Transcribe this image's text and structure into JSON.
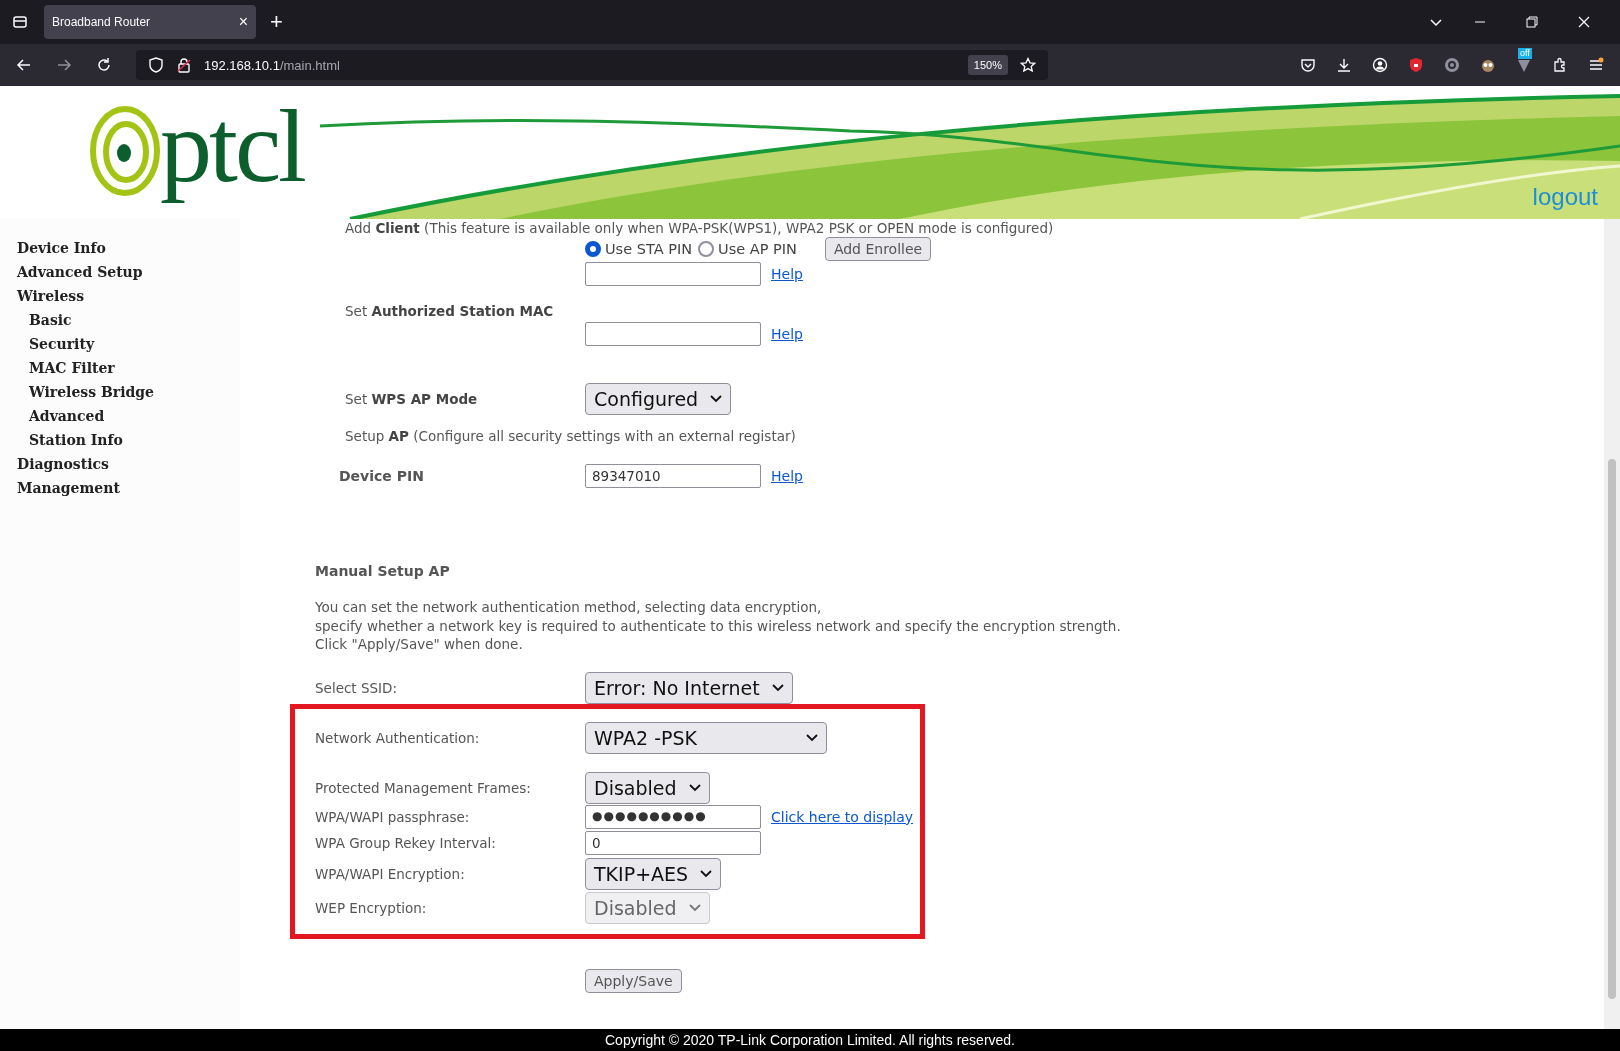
{
  "browser": {
    "tab_title": "Broadband Router",
    "tab_close": "×",
    "new_tab": "+",
    "url_host": "192.168.10.1",
    "url_path": "/main.html",
    "zoom": "150%",
    "extension_badge": "off"
  },
  "header": {
    "logo": "ptcl",
    "logout": "logout"
  },
  "sidebar": {
    "items": [
      {
        "label": "Device Info"
      },
      {
        "label": "Advanced Setup"
      },
      {
        "label": "Wireless",
        "children": [
          {
            "label": "Basic"
          },
          {
            "label": "Security"
          },
          {
            "label": "MAC Filter"
          },
          {
            "label": "Wireless Bridge"
          },
          {
            "label": "Advanced"
          },
          {
            "label": "Station Info"
          }
        ]
      },
      {
        "label": "Diagnostics"
      },
      {
        "label": "Management"
      }
    ]
  },
  "wps": {
    "add_client": "Add **Client** (This feature is available only when WPA-PSK(WPS1), WPA2 PSK or OPEN mode is configured)",
    "pin_options": [
      {
        "label": "Use STA PIN",
        "selected": true
      },
      {
        "label": "Use AP PIN",
        "selected": false
      }
    ],
    "add_enrollee": "Add Enrollee",
    "pin_help": "Help",
    "station_mac_label": "Set **Authorized Station MAC**",
    "station_mac_help": "Help",
    "ap_mode_label": "Set **WPS AP Mode**",
    "ap_mode_value": "Configured",
    "setup_ap": "Setup **AP** (Configure all security settings with an external registar)",
    "device_pin_label": "Device PIN",
    "device_pin_value": "89347010",
    "device_pin_help": "Help"
  },
  "manual": {
    "title": "Manual Setup AP",
    "description": [
      "You can set the network authentication method, selecting data encryption,",
      "specify whether a network key is required to authenticate to this wireless network and specify the encryption strength.",
      "Click \"Apply/Save\" when done."
    ],
    "fields": [
      {
        "kind": "select",
        "label": "Select SSID:",
        "value": "Error: No Internet",
        "disabled": false
      }
    ],
    "highlight_frame": {
      "fields": [
        {
          "kind": "select",
          "label": "Network Authentication:",
          "value": "WPA2 -PSK",
          "disabled": false
        },
        {
          "kind": "select",
          "label": "Protected Management Frames:",
          "value": "Disabled",
          "disabled": false
        },
        {
          "kind": "password",
          "label": "WPA/WAPI passphrase:",
          "value": "●●●●●●●●●●",
          "link": "Click here to display"
        },
        {
          "kind": "text",
          "label": "WPA Group Rekey Interval:",
          "value": "0"
        },
        {
          "kind": "select",
          "label": "WPA/WAPI Encryption:",
          "value": "TKIP+AES",
          "disabled": false
        },
        {
          "kind": "select",
          "label": "WEP Encryption:",
          "value": "Disabled",
          "disabled": true
        }
      ]
    },
    "apply": "Apply/Save"
  },
  "footer": {
    "copyright": "Copyright © 2020 TP-Link Corporation Limited. All rights reserved."
  }
}
